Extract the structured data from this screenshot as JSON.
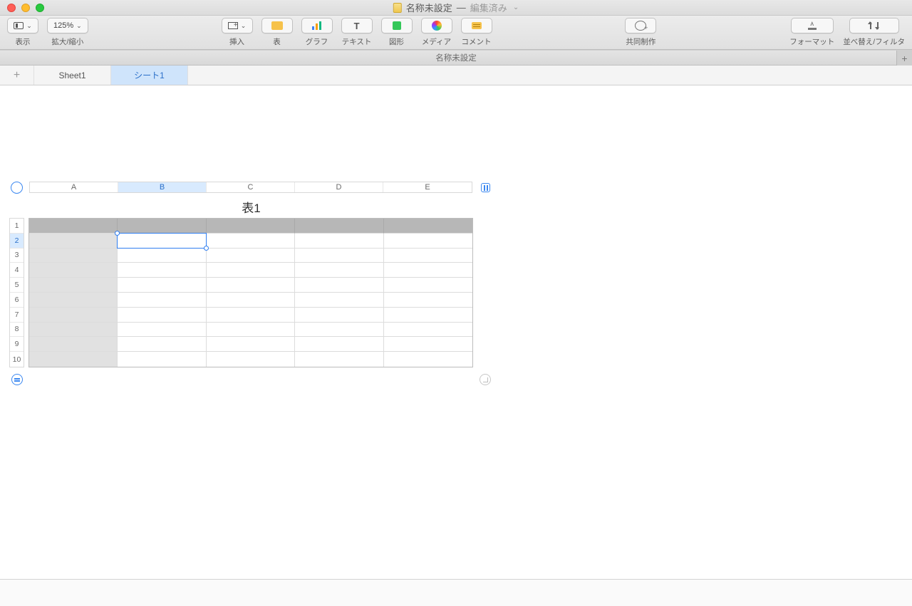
{
  "window": {
    "title_filename": "名称未設定",
    "title_separator": " — ",
    "title_edited": "編集済み"
  },
  "toolbar": {
    "view_label": "表示",
    "zoom_value": "125%",
    "zoom_label": "拡大/縮小",
    "insert_label": "挿入",
    "table_label": "表",
    "chart_label": "グラフ",
    "text_label": "テキスト",
    "text_glyph": "T",
    "shape_label": "図形",
    "media_label": "メディア",
    "comment_label": "コメント",
    "collab_label": "共同制作",
    "format_label": "フォーマット",
    "sort_label": "並べ替え/フィルタ"
  },
  "subheader": {
    "doc_name": "名称未設定"
  },
  "tabs": {
    "items": [
      "Sheet1",
      "シート1"
    ],
    "active_index": 1
  },
  "spreadsheet": {
    "table_title": "表1",
    "columns": [
      "A",
      "B",
      "C",
      "D",
      "E"
    ],
    "rows": [
      "1",
      "2",
      "3",
      "4",
      "5",
      "6",
      "7",
      "8",
      "9",
      "10"
    ],
    "selected_column_index": 1,
    "selected_row_index": 1
  }
}
